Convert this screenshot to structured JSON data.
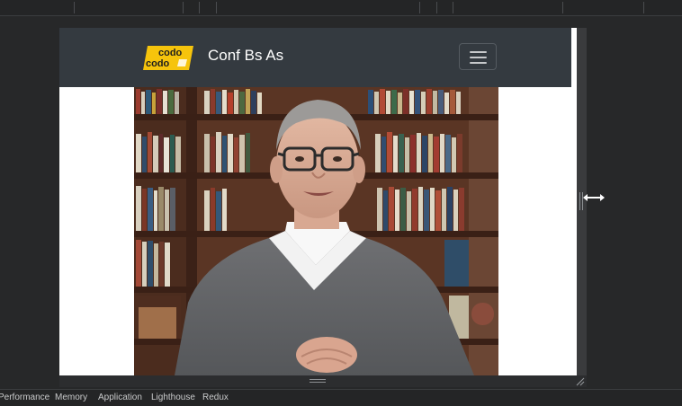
{
  "header": {
    "logo_line1": "codo",
    "logo_line2": "codo",
    "title": "Conf Bs As"
  },
  "navbar": {
    "toggler_icon": "hamburger-icon"
  },
  "video": {
    "subject": "man-in-gray-sweater-speaking-bookshelf"
  },
  "devtools_tabs": [
    {
      "label": "Performance"
    },
    {
      "label": "Memory"
    },
    {
      "label": "Application"
    },
    {
      "label": "Lighthouse"
    },
    {
      "label": "Redux"
    }
  ],
  "colors": {
    "navbar_bg": "#343a40",
    "brand_yellow": "#f6c40c",
    "devtools_bg": "#272829"
  }
}
